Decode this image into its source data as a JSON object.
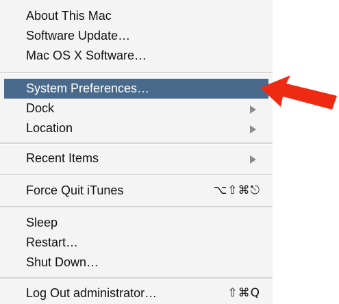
{
  "menu": {
    "group1": [
      {
        "label": "About This Mac"
      },
      {
        "label": "Software Update…"
      },
      {
        "label": "Mac OS X Software…"
      }
    ],
    "group2": [
      {
        "label": "System Preferences…"
      },
      {
        "label": "Dock"
      },
      {
        "label": "Location"
      }
    ],
    "recent_items": {
      "label": "Recent Items"
    },
    "force_quit": {
      "label": "Force Quit iTunes",
      "shortcut": "⌥⇧⌘⎋"
    },
    "group5": [
      {
        "label": "Sleep"
      },
      {
        "label": "Restart…"
      },
      {
        "label": "Shut Down…"
      }
    ],
    "log_out": {
      "label": "Log Out administrator…",
      "shortcut": "⇧⌘Q"
    }
  },
  "icons": {
    "submenu": "triangle-right-icon",
    "callout": "red-arrow-icon"
  },
  "colors": {
    "menu_background": "#f4f4f4",
    "highlight": "#4a6a8c",
    "callout_arrow": "#ee2a12"
  }
}
